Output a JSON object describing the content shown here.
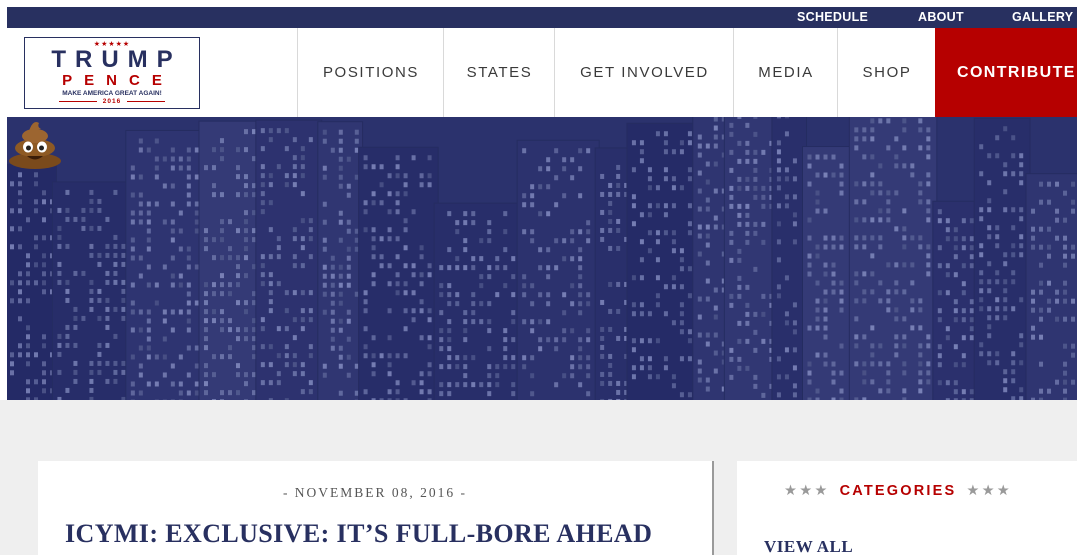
{
  "util_nav": [
    "SCHEDULE",
    "ABOUT",
    "GALLERY"
  ],
  "logo": {
    "stars": "★★★★★",
    "line1": "TRUMP",
    "line2": "PENCE",
    "tagline": "MAKE AMERICA GREAT AGAIN!",
    "year": "2016"
  },
  "main_nav": [
    "POSITIONS",
    "STATES",
    "GET INVOLVED",
    "MEDIA",
    "SHOP"
  ],
  "contribute_label": "CONTRIBUTE",
  "hero": {
    "emoji": "pile-of-poo-emoji"
  },
  "article": {
    "date": "- NOVEMBER 08, 2016 -",
    "title": "ICYMI: EXCLUSIVE: IT’S FULL-BORE AHEAD"
  },
  "sidebar": {
    "stars_left": "★★★",
    "heading": "CATEGORIES",
    "stars_right": "★★★",
    "view_all": "VIEW ALL"
  },
  "colors": {
    "navy": "#283060",
    "red": "#b60000",
    "hero_tint": "#2f3770"
  }
}
